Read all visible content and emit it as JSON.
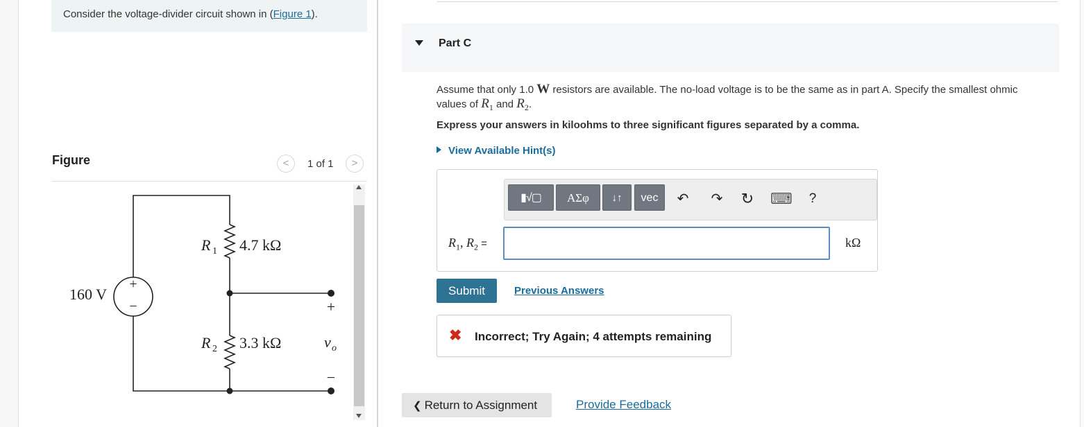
{
  "intro": {
    "text_before": "Consider the voltage-divider circuit shown in (",
    "figure_link": "Figure 1",
    "text_after": ")."
  },
  "figure": {
    "label": "Figure",
    "count": "1 of 1",
    "prev_glyph": "<",
    "next_glyph": ">"
  },
  "circuit": {
    "source_voltage": "160 V",
    "source_plus": "+",
    "source_minus": "−",
    "r1_name": "R",
    "r1_sub": "1",
    "r1_value": "4.7 kΩ",
    "r2_name": "R",
    "r2_sub": "2",
    "r2_value": "3.3 kΩ",
    "out_plus": "+",
    "out_minus": "−",
    "out_var": "v",
    "out_sub": "o"
  },
  "part": {
    "title": "Part C",
    "question_1": "Assume that only 1.0 ",
    "question_w": "W",
    "question_2": " resistors are available. The no-load voltage is to be the same as in part A. Specify the smallest ohmic values of ",
    "question_r": "R",
    "question_r1_sub": "1",
    "question_and": " and ",
    "question_r2_sub": "2",
    "question_end": ".",
    "instruction": "Express your answers in kiloohms to three significant figures separated by a comma.",
    "hint_link": "View Available Hint(s)"
  },
  "toolbar": {
    "templates_glyph": "▮√▢",
    "greek_label": "ΑΣφ",
    "arrows_label": "↓↑",
    "vec_label": "vec",
    "undo_glyph": "↶",
    "redo_glyph": "↷",
    "reset_glyph": "↻",
    "keyboard_glyph": "⌨",
    "help_glyph": "?"
  },
  "answer": {
    "label_r": "R",
    "label_sub1": "1",
    "label_comma": ", ",
    "label_sub2": "2",
    "label_eq": " =",
    "value": "",
    "unit": "kΩ"
  },
  "actions": {
    "submit_label": "Submit",
    "previous_answers_label": "Previous Answers",
    "return_label": "Return to Assignment",
    "return_glyph": "❮",
    "provide_feedback_label": "Provide Feedback"
  },
  "feedback": {
    "icon": "✖",
    "message": "Incorrect; Try Again; 4 attempts remaining"
  },
  "colors": {
    "link": "#1a6c9c",
    "submit_bg": "#2f7394",
    "error": "#d0281b",
    "toolbar_button": "#707780"
  }
}
